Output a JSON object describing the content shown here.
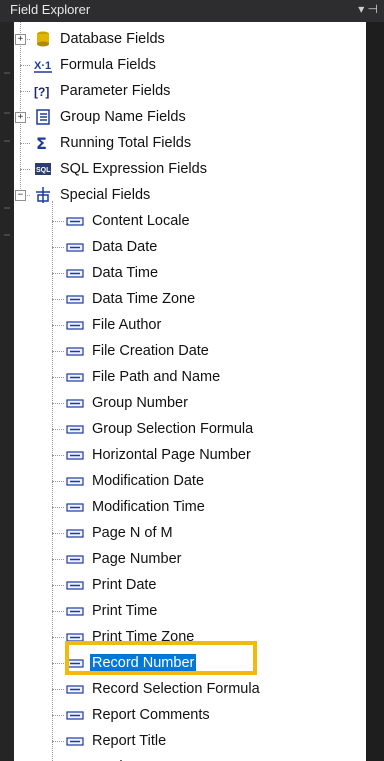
{
  "window": {
    "title": "Field Explorer",
    "pin_glyph": "▾ ⊣"
  },
  "tree": {
    "top": [
      {
        "label": "Database Fields",
        "icon": "database-icon",
        "expandable": true,
        "expander": "+"
      },
      {
        "label": "Formula Fields",
        "icon": "formula-icon",
        "icon_text": "X·1"
      },
      {
        "label": "Parameter Fields",
        "icon": "parameter-icon",
        "icon_text": "[?]"
      },
      {
        "label": "Group Name Fields",
        "icon": "group-name-icon",
        "expandable": true,
        "expander": "+"
      },
      {
        "label": "Running Total Fields",
        "icon": "sigma-icon",
        "icon_text": "Σ"
      },
      {
        "label": "SQL Expression Fields",
        "icon": "sql-icon",
        "icon_text": "SQL"
      },
      {
        "label": "Special Fields",
        "icon": "special-fields-icon",
        "expandable": true,
        "expander": "−"
      }
    ],
    "special_children": [
      "Content Locale",
      "Data Date",
      "Data Time",
      "Data Time Zone",
      "File Author",
      "File Creation Date",
      "File Path and Name",
      "Group Number",
      "Group Selection Formula",
      "Horizontal Page Number",
      "Modification Date",
      "Modification Time",
      "Page N of M",
      "Page Number",
      "Print Date",
      "Print Time",
      "Print Time Zone",
      "Record Number",
      "Record Selection Formula",
      "Report Comments",
      "Report Title",
      "Total Page Count"
    ],
    "selected": "Record Number"
  },
  "colors": {
    "selection": "#0078d7",
    "highlight_box": "#f2b90f",
    "title_bg": "#2d2d30"
  }
}
